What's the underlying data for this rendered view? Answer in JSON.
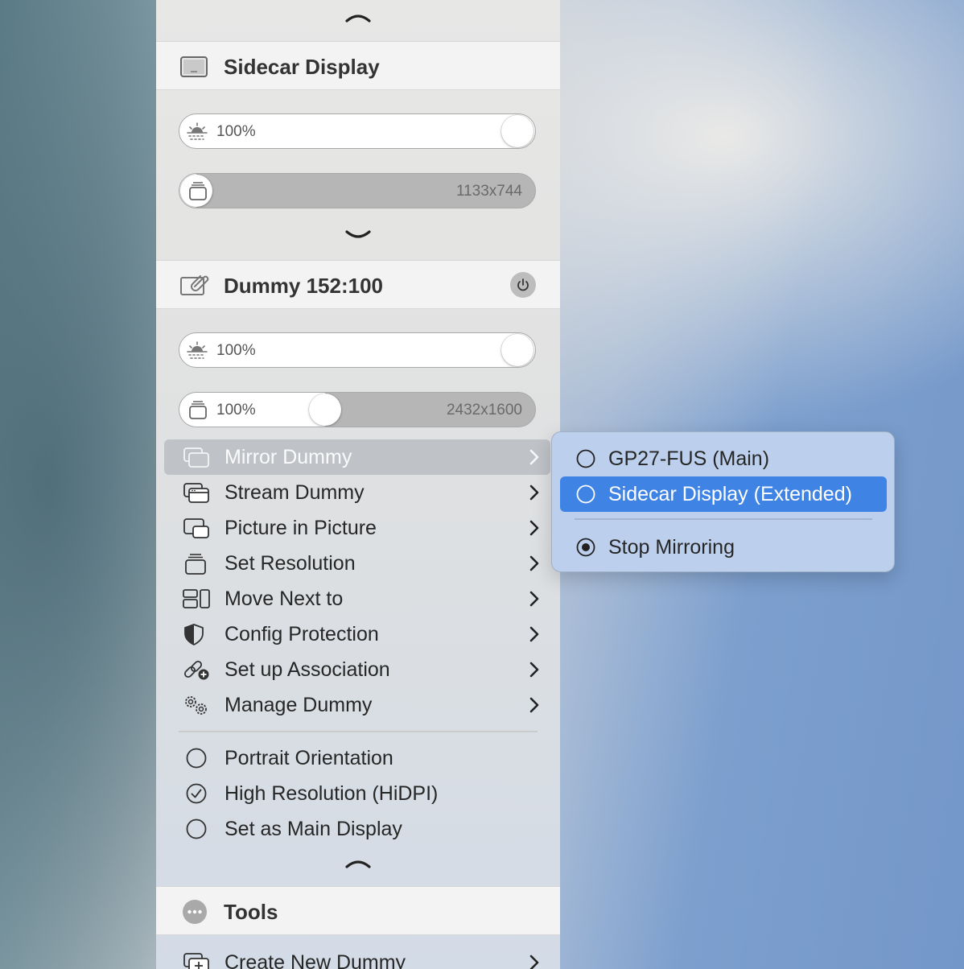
{
  "sidecar": {
    "title": "Sidecar Display",
    "brightness_label": "100%",
    "brightness_level": 1.0,
    "resolution_level": 0.0,
    "resolution_label": "",
    "resolution_value": "1133x744"
  },
  "dummy": {
    "title": "Dummy 152:100",
    "brightness_label": "100%",
    "brightness_level": 1.0,
    "resolution_level": 0.4,
    "resolution_label": "100%",
    "resolution_value": "2432x1600"
  },
  "menu": {
    "items": [
      {
        "label": "Mirror Dummy",
        "icon": "mirror-icon"
      },
      {
        "label": "Stream Dummy",
        "icon": "stream-icon"
      },
      {
        "label": "Picture in Picture",
        "icon": "pip-icon"
      },
      {
        "label": "Set Resolution",
        "icon": "resolution-stack-icon"
      },
      {
        "label": "Move Next to",
        "icon": "arrangement-icon"
      },
      {
        "label": "Config Protection",
        "icon": "shield-icon"
      },
      {
        "label": "Set up Association",
        "icon": "link-add-icon"
      },
      {
        "label": "Manage Dummy",
        "icon": "gears-icon"
      }
    ],
    "options": [
      {
        "label": "Portrait Orientation",
        "checked": false
      },
      {
        "label": "High Resolution (HiDPI)",
        "checked": true
      },
      {
        "label": "Set as Main Display",
        "checked": false
      }
    ]
  },
  "submenu": {
    "items": [
      {
        "label": "GP27-FUS (Main)"
      },
      {
        "label": "Sidecar Display (Extended)"
      },
      {
        "label": "Stop Mirroring"
      }
    ]
  },
  "tools": {
    "title": "Tools",
    "create_label": "Create New Dummy"
  },
  "colors": {
    "highlight": "#3f84e5",
    "submenu_bg": "#bcd0ed",
    "header_bg": "#f3f3f3"
  }
}
